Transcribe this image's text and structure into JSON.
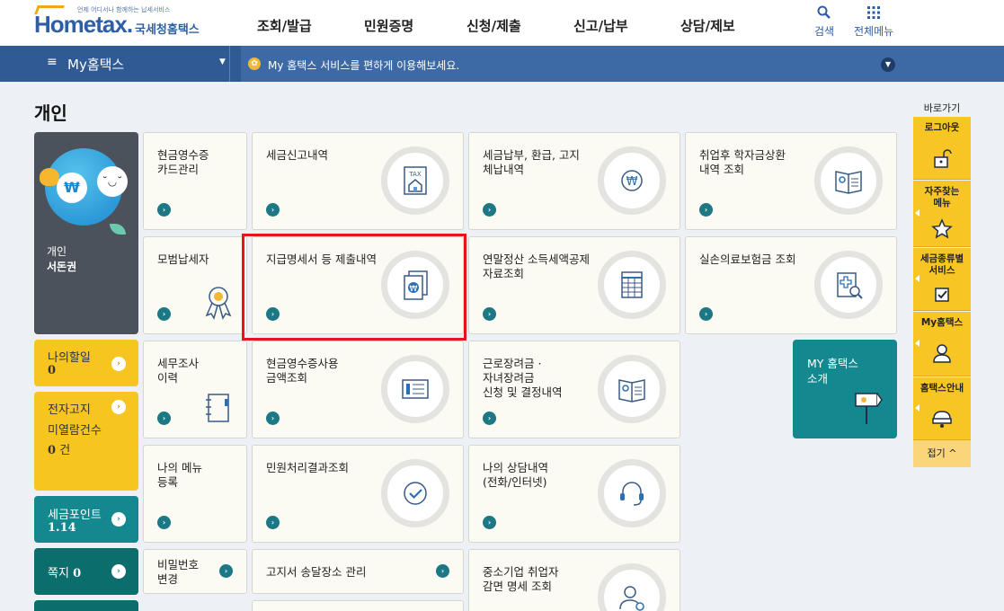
{
  "header": {
    "logo_tagline": "언제 어디서나 함께하는 납세서비스",
    "logo_word": "Hometax.",
    "logo_kor": "국세청홈택스",
    "gnb": [
      "조회/발급",
      "민원증명",
      "신청/제출",
      "신고/납부",
      "상담/제보"
    ],
    "search_label": "검색",
    "all_menu_label": "전체메뉴",
    "accent": "#2d5fa6"
  },
  "subbar": {
    "my_label": "My홈택스",
    "notice": "My 홈택스 서비스를 편하게 이용해보세요."
  },
  "page": {
    "title": "개인"
  },
  "profile": {
    "role": "개인",
    "name": "서돈권"
  },
  "left_boxes": {
    "todo_label": "나의할일",
    "todo_count": "0",
    "ebill_label1": "전자고지",
    "ebill_label2": "미열람건수",
    "ebill_count": "0",
    "ebill_unit": "건",
    "points_label": "세금포인트",
    "points_value": "1.14",
    "memo_label": "쪽지",
    "memo_count": "0"
  },
  "cards": {
    "c1": "현금영수증\n카드관리",
    "c2": "세금신고내역",
    "c3": "세금납부, 환급, 고지\n체납내역",
    "c4": "취업후 학자금상환\n내역 조회",
    "c5": "모범납세자",
    "c6": "지급명세서 등 제출내역",
    "c7": "연말정산 소득세액공제\n자료조회",
    "c8": "실손의료보험금 조회",
    "c9": "세무조사\n이력",
    "c10": "현금영수증사용\n금액조회",
    "c11": "근로장려금 ·\n자녀장려금\n신청 및 결정내역",
    "c13": "나의 메뉴\n등록",
    "c14": "민원처리결과조회",
    "c15": "나의 상담내역\n(전화/인터넷)",
    "c16": "비밀번호\n변경",
    "c17": "고지서 송달장소 관리",
    "c18": "중소기업 취업자\n감면 명세 조회",
    "tax_icon_text": "TAX"
  },
  "my_intro": "MY 홈택스\n소개",
  "quick": {
    "title": "바로가기",
    "logout": "로그아웃",
    "faq": "자주찾는\n메뉴",
    "taxservice": "세금종류별\n서비스",
    "myhometax": "My홈택스",
    "guide": "홈택스안내",
    "fold": "접기 ^"
  }
}
